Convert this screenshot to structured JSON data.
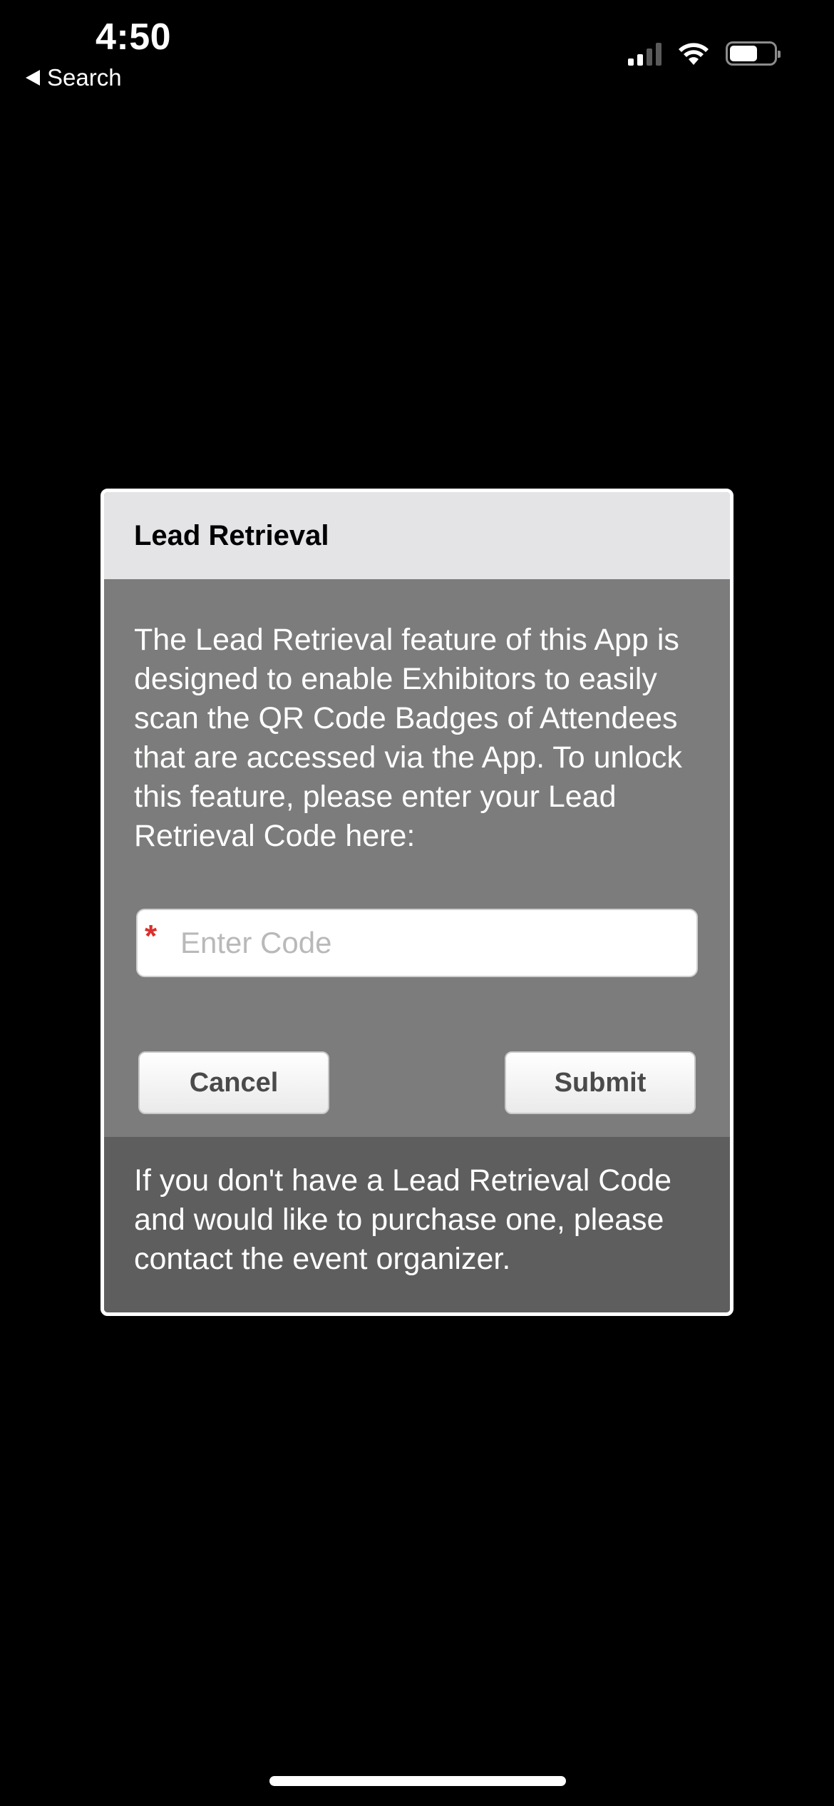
{
  "status_bar": {
    "time": "4:50",
    "back_label": "Search",
    "icons": [
      "cellular-signal-icon",
      "wifi-icon",
      "battery-icon"
    ]
  },
  "dialog": {
    "title": "Lead Retrieval",
    "description": "The Lead Retrieval feature of this App is designed to enable Exhibitors to easily scan the QR Code Badges of Attendees that are accessed via the App. To unlock this feature, please enter your Lead Retrieval Code here:",
    "code_field": {
      "required_marker": "*",
      "placeholder": "Enter Code",
      "value": ""
    },
    "cancel_label": "Cancel",
    "submit_label": "Submit",
    "footer_text": "If you don't have a Lead Retrieval Code and would like to purchase one, please contact the event organizer."
  },
  "colors": {
    "header_bg": "#e4e4e6",
    "body_bg": "#7b7c7b",
    "footer_bg": "#5e5e5e",
    "required": "#d9302c"
  }
}
